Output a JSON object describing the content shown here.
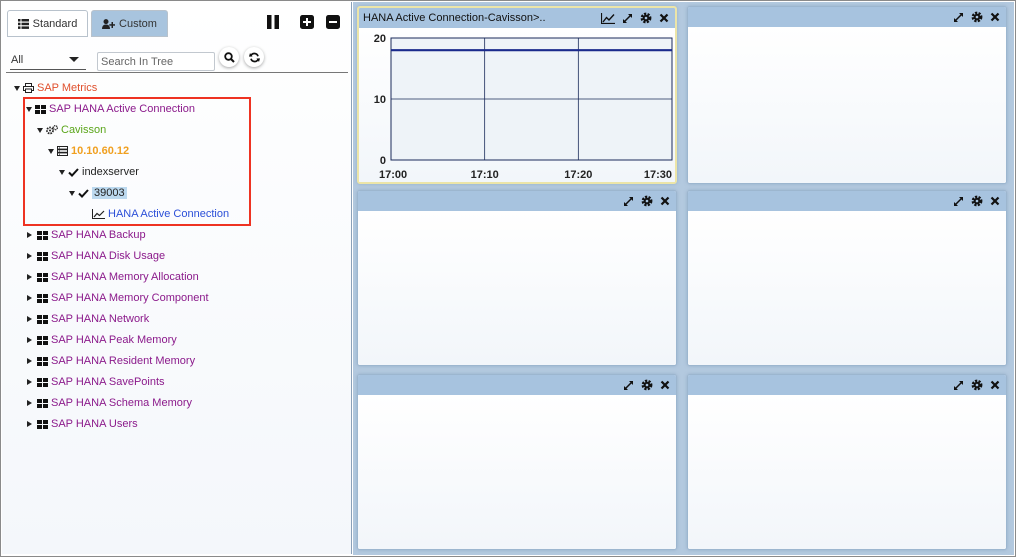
{
  "tabs": [
    {
      "label": "Standard",
      "icon": "list-icon",
      "active": true
    },
    {
      "label": "Custom",
      "icon": "add-user-icon",
      "active": false
    }
  ],
  "toolbar": {
    "pause": "pause-icon",
    "expand_all": "plus-square-icon",
    "collapse_all": "minus-square-icon"
  },
  "filter": {
    "selected": "All"
  },
  "search": {
    "placeholder": "Search In Tree"
  },
  "tree": {
    "root": "SAP Metrics",
    "active_connection": "SAP HANA Active Connection",
    "tier": "Cavisson",
    "server": "10.10.60.12",
    "instance": "indexserver",
    "port": "39003",
    "metric": "HANA Active Connection",
    "groups": [
      "SAP HANA Backup",
      "SAP HANA Disk Usage",
      "SAP HANA Memory Allocation",
      "SAP HANA Memory Component",
      "SAP HANA Network",
      "SAP HANA Peak Memory",
      "SAP HANA Resident Memory",
      "SAP HANA SavePoints",
      "SAP HANA Schema Memory",
      "SAP HANA Users"
    ]
  },
  "panel1": {
    "title": "HANA Active Connection-Cavisson>.."
  },
  "chart_data": {
    "type": "line",
    "x": [
      "17:00",
      "17:10",
      "17:20",
      "17:30"
    ],
    "series": [
      {
        "values": [
          18,
          18,
          18,
          18
        ]
      }
    ],
    "ylim": [
      0,
      20
    ],
    "yticks": [
      "0",
      "10",
      "20"
    ],
    "grid": true,
    "color": "#1a2a8c"
  },
  "colors": {
    "accent": "#a7c3df",
    "highlight_box": "#e32222",
    "workspace": "#b3c9df"
  }
}
